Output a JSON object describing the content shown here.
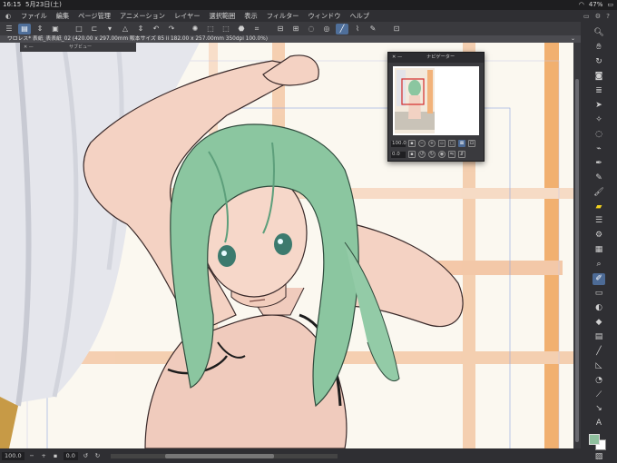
{
  "status_bar": {
    "time": "16:15",
    "date": "5月23日(土)",
    "wifi_icon": "wifi-icon",
    "battery_text": "47%"
  },
  "menu": {
    "items": [
      "ファイル",
      "編集",
      "ページ管理",
      "アニメーション",
      "レイヤー",
      "選択範囲",
      "表示",
      "フィルター",
      "ウィンドウ",
      "ヘルプ"
    ]
  },
  "document_tab": {
    "title": "ワロレス* 表紙_表表紙_02 (420.00 x 297.00mm 販本サイズ 85 ii 182.00 x 257.00mm 350dpi 100.0%)"
  },
  "subview_panel": {
    "title": "サブビュー"
  },
  "navigator_panel": {
    "title": "ナビゲーター",
    "zoom_value": "100.0",
    "rotation_value": "0.0"
  },
  "bottom_bar": {
    "zoom_value": "100.0",
    "rotation_value": "0.0"
  },
  "colors": {
    "accent": "#4d6b96",
    "main_color": "#8fc09e",
    "sub_color": "#ffffff"
  }
}
